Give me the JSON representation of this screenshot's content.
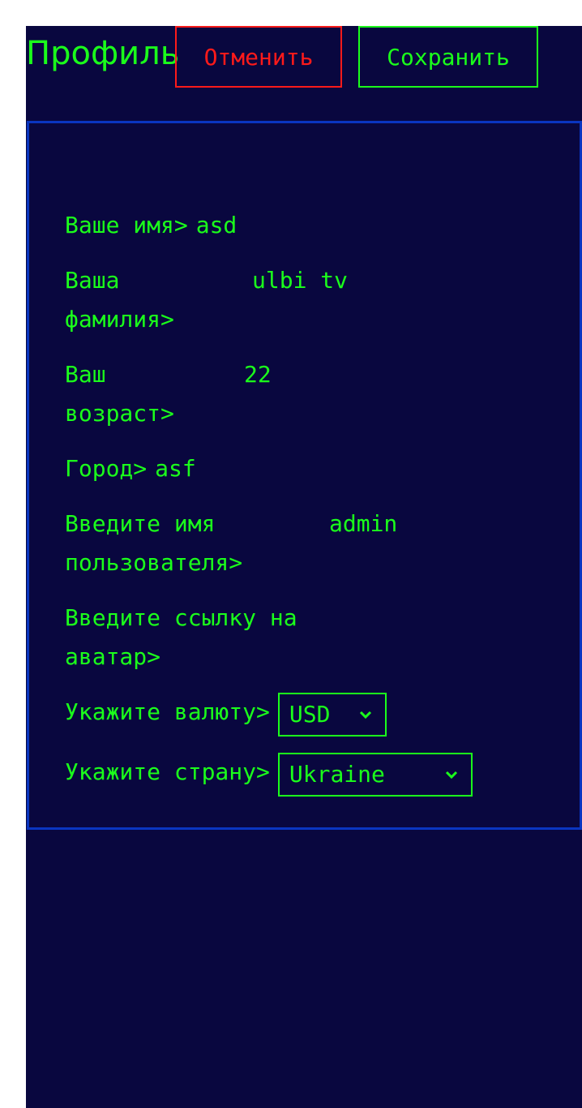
{
  "header": {
    "title": "Профиль",
    "cancel_label": "Отменить",
    "save_label": "Сохранить"
  },
  "form": {
    "first_name": {
      "label": "Ваше имя>",
      "value": "asd"
    },
    "last_name": {
      "label_line1": "Ваша",
      "label_line2": "фамилия>",
      "value": "ulbi tv"
    },
    "age": {
      "label_line1": "Ваш",
      "label_line2": "возраст>",
      "value": "22"
    },
    "city": {
      "label": "Город>",
      "value": "asf"
    },
    "username": {
      "label_line1": "Введите имя",
      "label_line2": "пользователя>",
      "value": "admin"
    },
    "avatar": {
      "label_line1": "Введите ссылку на",
      "label_line2": "аватар>",
      "value": ""
    },
    "currency": {
      "label": "Укажите валюту>",
      "selected": "USD"
    },
    "country": {
      "label": "Укажите страну>",
      "selected": "Ukraine"
    }
  },
  "icons": {
    "dropdown": "chevron-down-icon"
  },
  "colors": {
    "background": "#09073f",
    "accent_green": "#1bff1b",
    "cancel_red": "#ff1a1a",
    "card_border": "#0a35c0"
  }
}
